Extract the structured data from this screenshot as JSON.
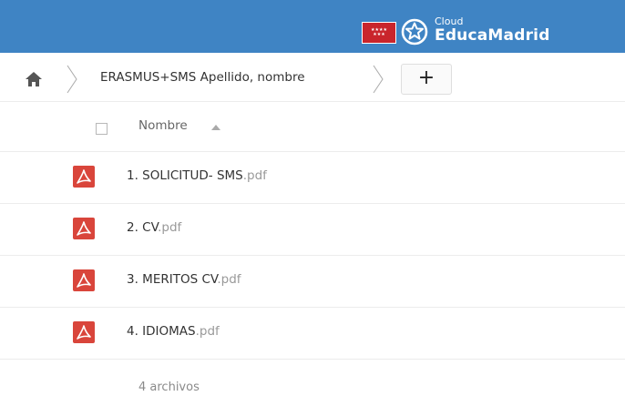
{
  "header": {
    "brand_small": "Cloud",
    "brand_big": "EducaMadrid",
    "colors": {
      "bar": "#3f84c4",
      "flag": "#c9252c"
    },
    "icons": [
      "madrid-flag-icon",
      "educamadrid-logo-icon"
    ]
  },
  "breadcrumb": {
    "home_icon": "home-icon",
    "folder": "ERASMUS+SMS Apellido, nombre",
    "add_label": "+"
  },
  "list": {
    "column_name": "Nombre",
    "sort": "ascending",
    "files": [
      {
        "name": "1. SOLICITUD- SMS",
        "ext": ".pdf",
        "icon": "pdf-icon"
      },
      {
        "name": "2. CV",
        "ext": ".pdf",
        "icon": "pdf-icon"
      },
      {
        "name": "3. MERITOS CV",
        "ext": ".pdf",
        "icon": "pdf-icon"
      },
      {
        "name": "4. IDIOMAS",
        "ext": ".pdf",
        "icon": "pdf-icon"
      }
    ],
    "summary": "4 archivos"
  }
}
